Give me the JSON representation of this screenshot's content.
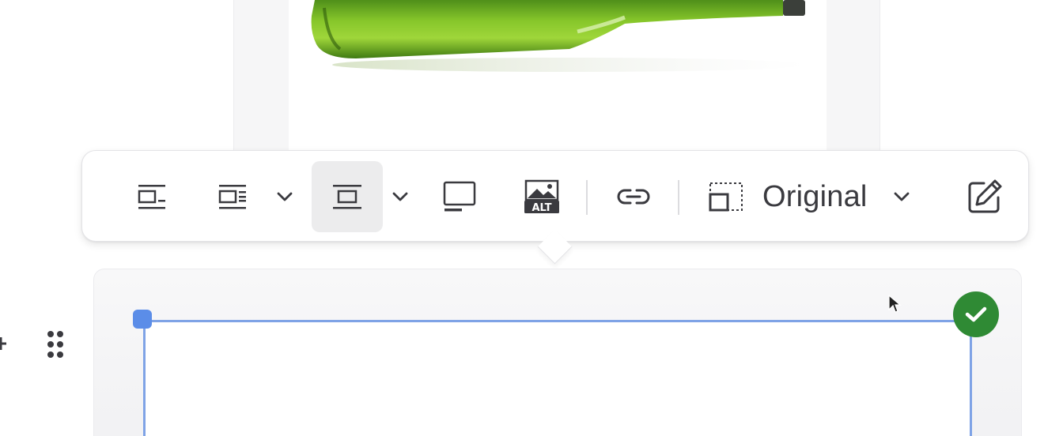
{
  "toolbar": {
    "buttons": [
      {
        "icon": "align-left-inline-icon",
        "active": false
      },
      {
        "icon": "wrap-text-left-icon",
        "active": false
      },
      {
        "icon": "align-center-icon",
        "active": true
      },
      {
        "icon": "full-width-monitor-icon",
        "active": false
      },
      {
        "icon": "alt-text-icon",
        "alt_label": "ALT",
        "active": false
      },
      {
        "icon": "link-icon",
        "active": false
      },
      {
        "icon": "resize-icon",
        "active": false
      },
      {
        "icon": "edit-pencil-icon",
        "active": false
      }
    ],
    "size_value": "Original"
  },
  "colors": {
    "selection_border": "#7fa3e6",
    "handle": "#5b8de8",
    "confirm": "#2f8a34",
    "active_button_bg": "#ececed"
  }
}
